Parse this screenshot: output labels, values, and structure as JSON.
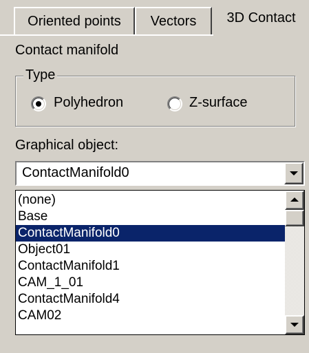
{
  "tabs": [
    {
      "label": "Oriented points",
      "active": false
    },
    {
      "label": "Vectors",
      "active": false
    },
    {
      "label": "3D Contact",
      "active": true
    }
  ],
  "panel": {
    "title": "Contact manifold",
    "type_group": {
      "title": "Type",
      "options": [
        {
          "label": "Polyhedron",
          "selected": true
        },
        {
          "label": "Z-surface",
          "selected": false
        }
      ]
    },
    "graphical_object": {
      "label": "Graphical object:",
      "selected_value": "ContactManifold0",
      "items": [
        "(none)",
        "Base",
        "ContactManifold0",
        "Object01",
        "ContactManifold1",
        "CAM_1_01",
        "ContactManifold4",
        "CAM02"
      ],
      "highlighted_item": "ContactManifold0"
    }
  },
  "colors": {
    "face": "#d4d0c8",
    "selection": "#0a246a"
  }
}
